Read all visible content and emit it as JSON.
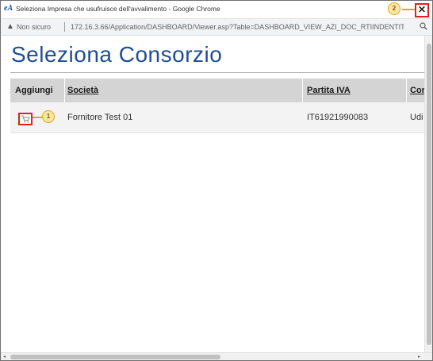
{
  "window": {
    "app_icon": "eA",
    "title": "Seleziona Impresa che usufruisce dell'avvalimento - Google Chrome",
    "close_label": "✕"
  },
  "markers": {
    "close_marker": "2",
    "cart_marker": "1"
  },
  "addressbar": {
    "warning_icon": "warning-triangle-icon",
    "security_label": "Non sicuro",
    "url": "172.16.3.66/Application/DASHBOARD/Viewer.asp?Table=DASHBOARD_VIEW_AZI_DOC_RTIINDENTITY...",
    "zoom_icon": "magnifier-icon"
  },
  "page": {
    "title": "Seleziona Consorzio"
  },
  "table": {
    "headers": {
      "add": "Aggiungi",
      "company": "Società",
      "vat": "Partita IVA",
      "next": "Cor"
    },
    "rows": [
      {
        "company": "Fornitore Test 01",
        "vat": "IT61921990083",
        "next": "Udi"
      }
    ]
  },
  "colors": {
    "title_blue": "#1f4e96",
    "highlight_red": "#e02020",
    "marker_orange": "#e8a317",
    "header_gray": "#d4d4d4"
  },
  "scrollbars": {
    "left_arrow": "◂",
    "right_arrow": "▸"
  }
}
